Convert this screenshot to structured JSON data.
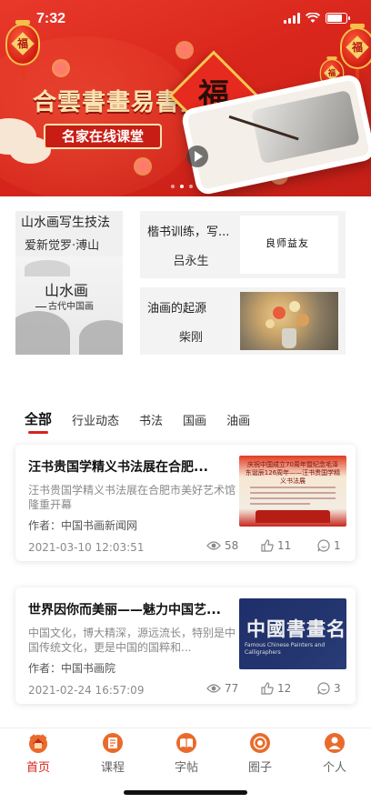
{
  "status_bar": {
    "time": "7:32"
  },
  "banner": {
    "title": "合雲書畫易書秀",
    "subtitle": "名家在线课堂",
    "fu_character": "福",
    "lantern_character": "福",
    "colors": {
      "background": "#d9261c",
      "gold": "#f4c04a"
    }
  },
  "featured": {
    "left": {
      "title": "山水画写生技法",
      "author": "爱新觉罗·溥山",
      "thumb_title": "山水画",
      "thumb_subtitle": "古代中国画"
    },
    "cards": [
      {
        "title": "楷书训练，写...",
        "author": "吕永生",
        "thumb_text": "良师益友"
      },
      {
        "title": "油画的起源",
        "author": "柴刚"
      }
    ]
  },
  "tabs": [
    {
      "label": "全部",
      "active": true
    },
    {
      "label": "行业动态",
      "active": false
    },
    {
      "label": "书法",
      "active": false
    },
    {
      "label": "国画",
      "active": false
    },
    {
      "label": "油画",
      "active": false
    }
  ],
  "articles": [
    {
      "title": "汪书贵国学精义书法展在合肥...",
      "summary": "汪书贵国学精义书法展在合肥市美好艺术馆隆重开幕",
      "author": "作者：中国书画新闻网",
      "date": "2021-03-10 12:03:51",
      "views": "58",
      "likes": "11",
      "comments": "1",
      "thumb_title": "庆祝中国成立70周年暨纪念毛泽东诞辰126周年——汪书贵国学精义书法展"
    },
    {
      "title": "世界因你而美丽——魅力中国艺...",
      "summary": "中国文化，博大精深，源远流长，特别是中国传统文化，更是中国的国粹和...",
      "author": "作者：中国书画院",
      "date": "2021-02-24 16:57:09",
      "views": "77",
      "likes": "12",
      "comments": "3",
      "thumb_title": "中國書畫名家",
      "thumb_subtitle": "Famous Chinese Painters and Calligraphers"
    }
  ],
  "bottom_nav": [
    {
      "label": "首页",
      "icon": "home-icon",
      "active": true
    },
    {
      "label": "课程",
      "icon": "course-icon",
      "active": false
    },
    {
      "label": "字帖",
      "icon": "copybook-icon",
      "active": false
    },
    {
      "label": "圈子",
      "icon": "circle-icon",
      "active": false
    },
    {
      "label": "个人",
      "icon": "profile-icon",
      "active": false
    }
  ],
  "colors": {
    "accent": "#d6231b",
    "nav_icon": "#e96b2c",
    "muted": "#8a8a8a"
  }
}
